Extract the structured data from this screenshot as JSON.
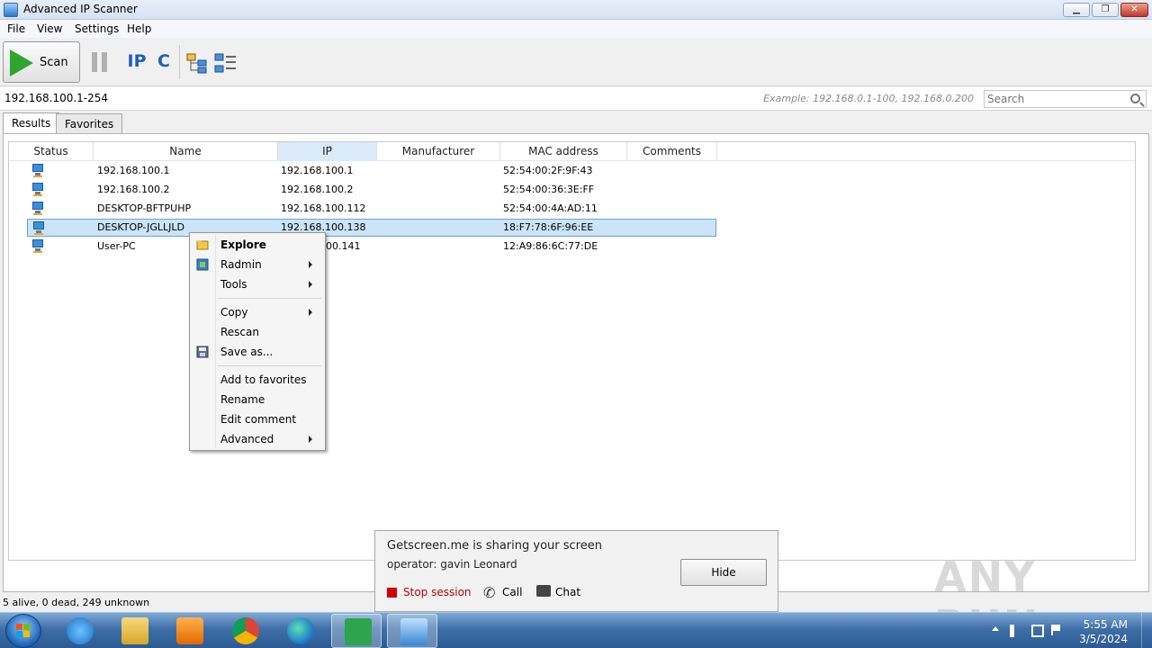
{
  "window": {
    "title": "Advanced IP Scanner",
    "minimize": "▁",
    "maximize": "❐",
    "close": "✕"
  },
  "menu": [
    "File",
    "View",
    "Settings",
    "Help"
  ],
  "toolbar": {
    "scan_label": "Scan",
    "ip_icon_label": "IP",
    "c_icon_label": "C"
  },
  "address": {
    "value": "192.168.100.1-254",
    "example": "Example: 192.168.0.1-100, 192.168.0.200"
  },
  "search": {
    "placeholder": "Search"
  },
  "tabs": [
    "Results",
    "Favorites"
  ],
  "columns": [
    "Status",
    "Name",
    "IP",
    "Manufacturer",
    "MAC address",
    "Comments"
  ],
  "rows": [
    {
      "name": "192.168.100.1",
      "ip": "192.168.100.1",
      "manufacturer": "",
      "mac": "52:54:00:2F:9F:43",
      "comments": ""
    },
    {
      "name": "192.168.100.2",
      "ip": "192.168.100.2",
      "manufacturer": "",
      "mac": "52:54:00:36:3E:FF",
      "comments": ""
    },
    {
      "name": "DESKTOP-BFTPUHP",
      "ip": "192.168.100.112",
      "manufacturer": "",
      "mac": "52:54:00:4A:AD:11",
      "comments": ""
    },
    {
      "name": "DESKTOP-JGLLJLD",
      "ip": "192.168.100.138",
      "manufacturer": "",
      "mac": "18:F7:78:6F:96:EE",
      "comments": ""
    },
    {
      "name": "User-PC",
      "ip": "00.141",
      "manufacturer": "",
      "mac": "12:A9:86:6C:77:DE",
      "comments": ""
    }
  ],
  "context_menu": {
    "explore": "Explore",
    "radmin": "Radmin",
    "tools": "Tools",
    "copy": "Copy",
    "rescan": "Rescan",
    "save_as": "Save as...",
    "add_favorites": "Add to favorites",
    "rename": "Rename",
    "edit_comment": "Edit comment",
    "advanced": "Advanced"
  },
  "status": {
    "text": "5 alive, 0 dead, 249 unknown"
  },
  "share_popup": {
    "line1": "Getscreen.me is sharing your screen",
    "line2": "operator: gavin Leonard",
    "stop_label": "Stop session",
    "call_label": "Call",
    "chat_label": "Chat",
    "hide_label": "Hide"
  },
  "watermark": "ANY RUN",
  "tray": {
    "time": "5:55 AM",
    "date": "3/5/2024"
  },
  "colors": {
    "accent": "#2fa52f",
    "selection": "#cce4f7",
    "stop": "#d40000",
    "taskbar": "#3f6fa7"
  },
  "taskbar_apps": [
    "windows-explorer-icon",
    "internet-explorer-icon",
    "file-explorer-icon",
    "media-player-icon",
    "chrome-icon",
    "edge-icon",
    "green-arrow-app-icon",
    "advanced-ip-scanner-icon"
  ]
}
